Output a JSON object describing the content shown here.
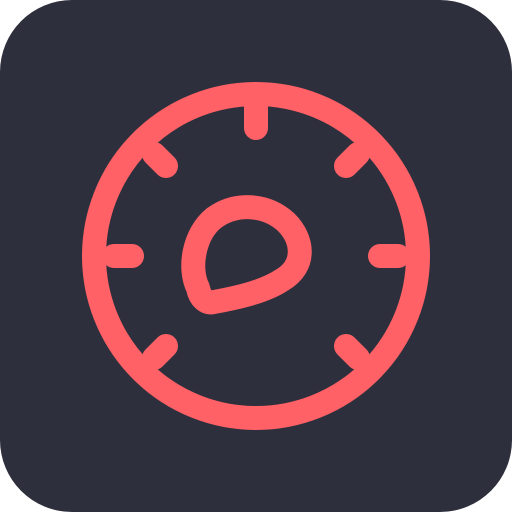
{
  "icon": {
    "name": "compass-dial-icon",
    "colors": {
      "background": "#2e2f3c",
      "accent": "#ff6166"
    }
  }
}
